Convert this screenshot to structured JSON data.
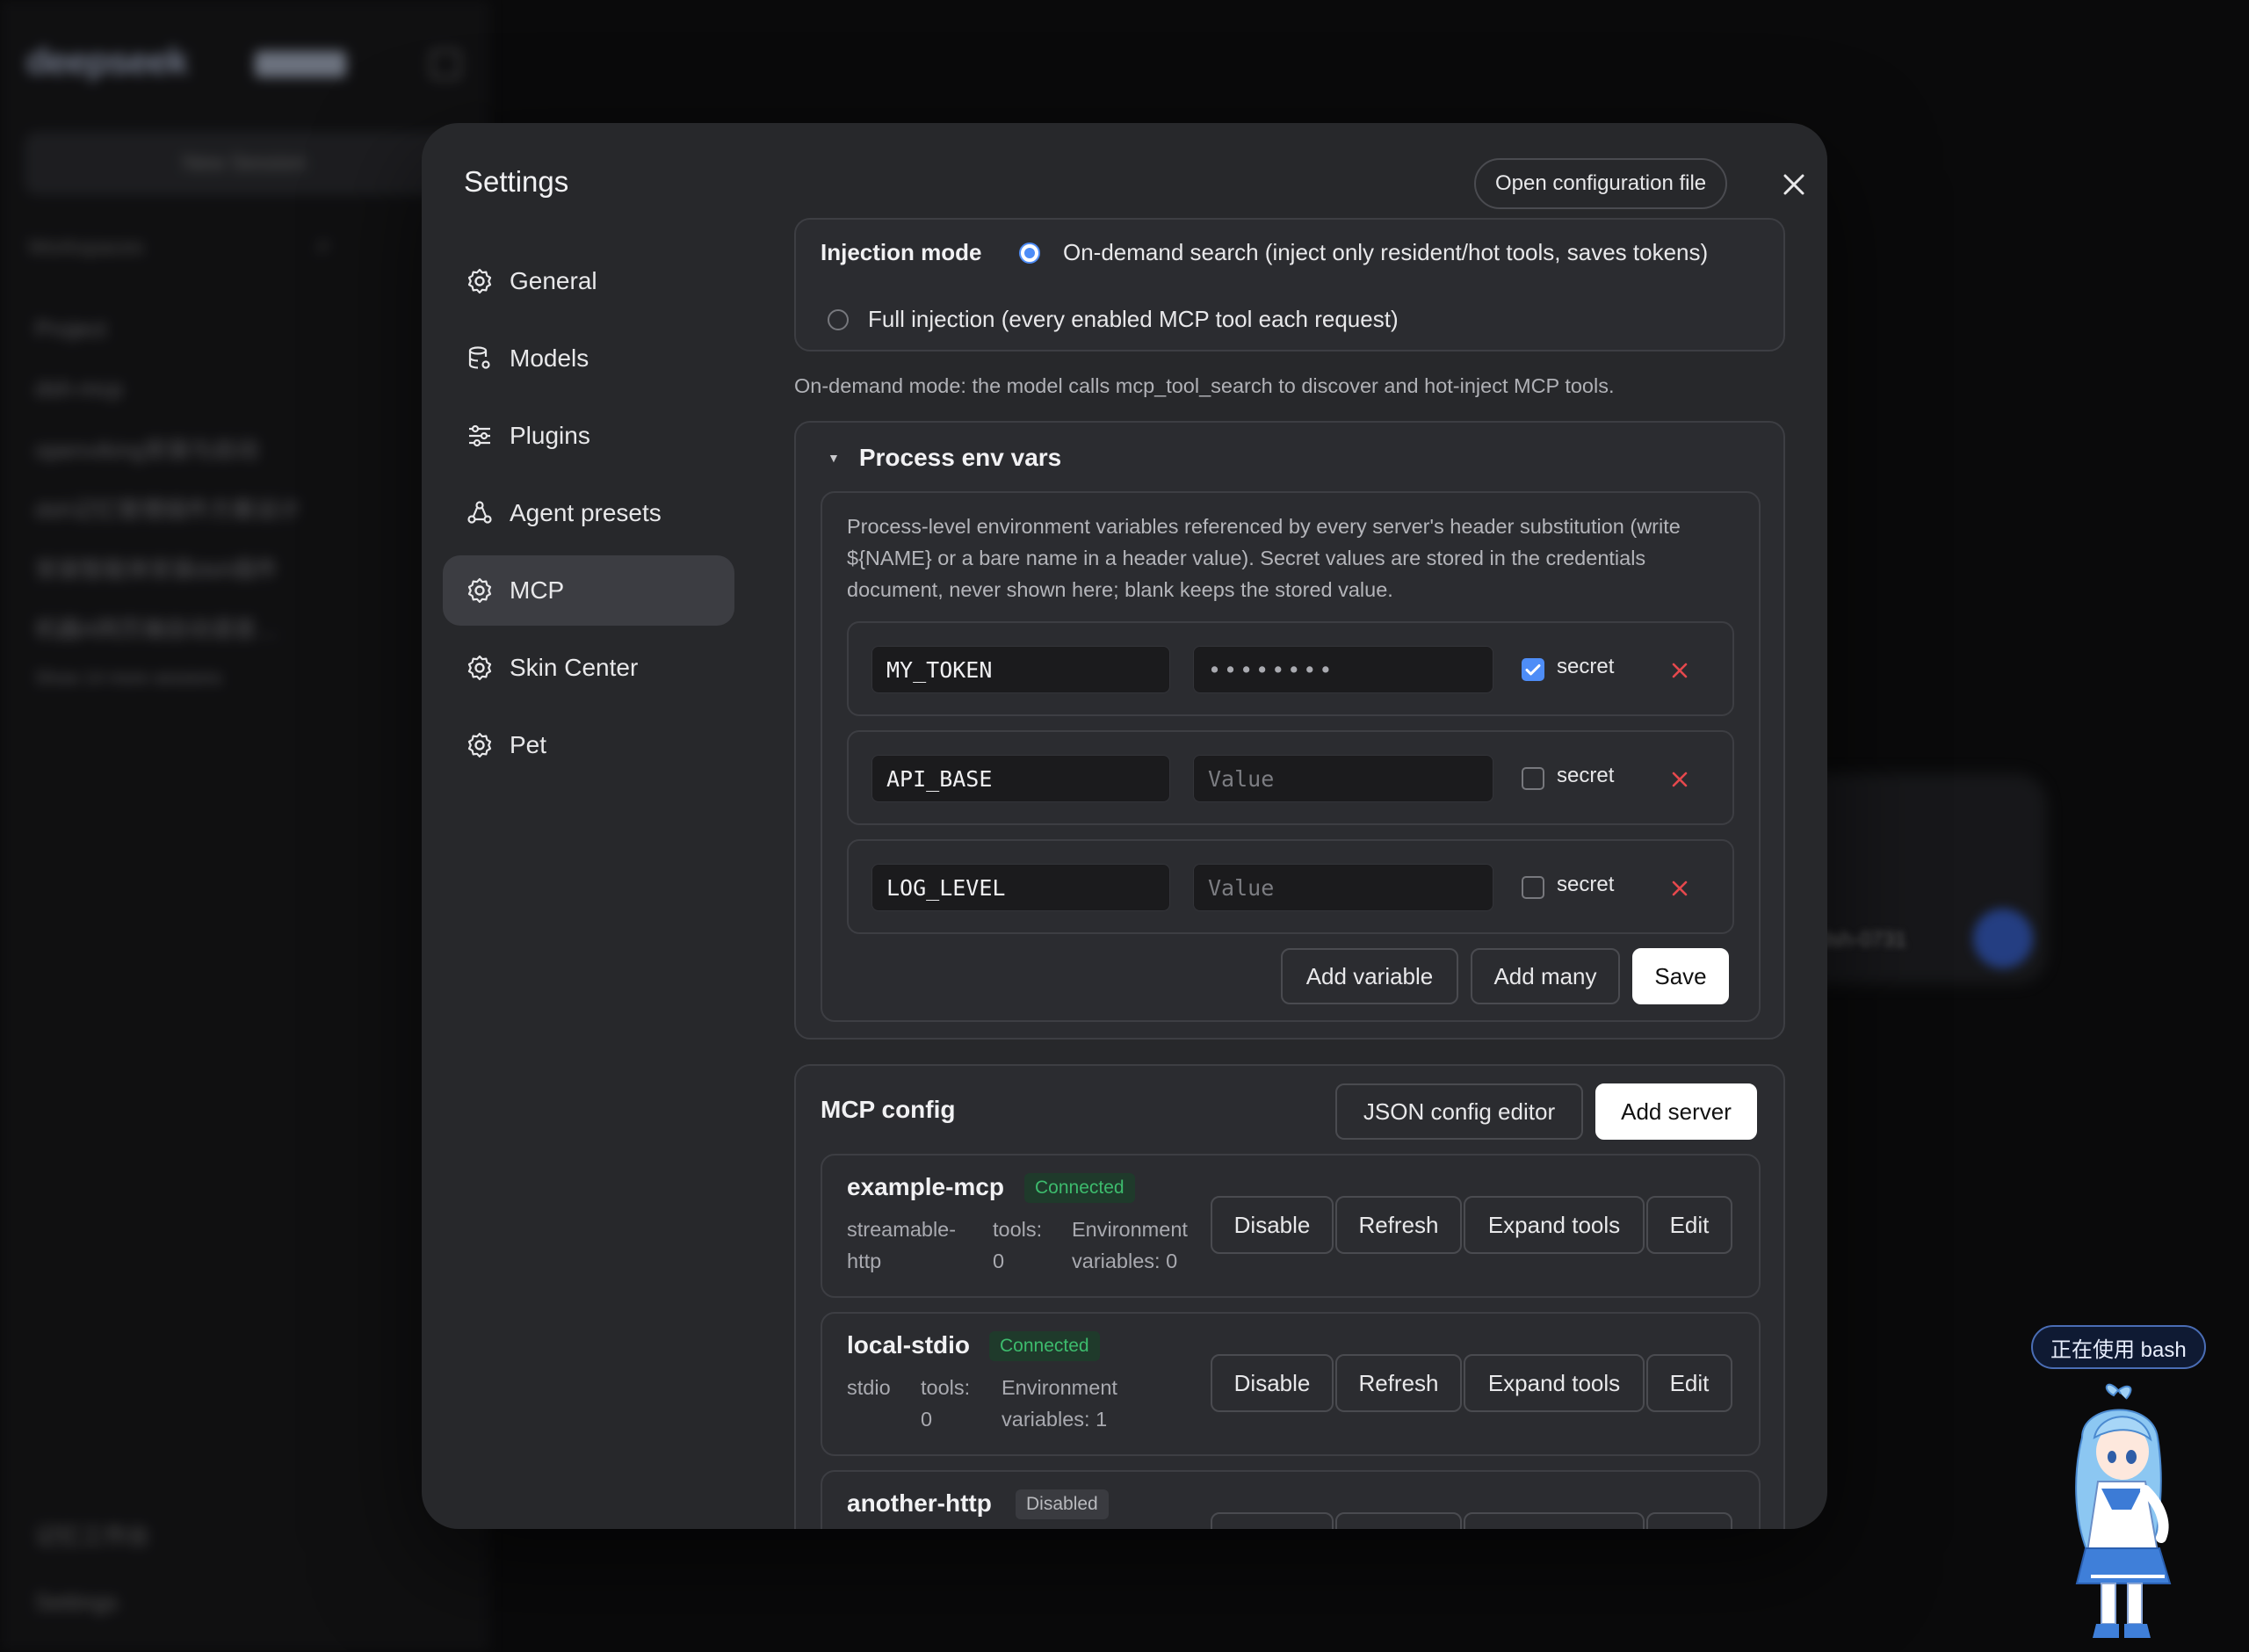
{
  "background": {
    "app_logo": "deepseek",
    "new_session": "New Session",
    "workspaces_label": "Workspaces",
    "sessions": [
      "Project",
      "dsh-mcp",
      "openviking安装与启动",
      "dsh记忆管理插件方案设计",
      "安装智能体安装dsh插件",
      "机器A网页端自动语音…"
    ],
    "show_more": "Show 14 more sessions",
    "footer_workspace": "记忆工作台",
    "footer_settings": "Settings",
    "card_text": "dsh-0731"
  },
  "dialog": {
    "title": "Settings",
    "open_config_label": "Open configuration file",
    "nav": [
      {
        "label": "General",
        "icon": "gear-icon"
      },
      {
        "label": "Models",
        "icon": "database-icon"
      },
      {
        "label": "Plugins",
        "icon": "sliders-icon"
      },
      {
        "label": "Agent presets",
        "icon": "agent-icon"
      },
      {
        "label": "MCP",
        "icon": "gear-icon",
        "active": true
      },
      {
        "label": "Skin Center",
        "icon": "gear-icon"
      },
      {
        "label": "Pet",
        "icon": "gear-icon"
      }
    ]
  },
  "injection": {
    "label": "Injection mode",
    "options": [
      {
        "label": "On-demand search (inject only resident/hot tools, saves tokens)",
        "selected": true
      },
      {
        "label": "Full injection (every enabled MCP tool each request)",
        "selected": false
      }
    ],
    "note": "On-demand mode: the model calls mcp_tool_search to discover and hot-inject MCP tools."
  },
  "env": {
    "title": "Process env vars",
    "description": "Process-level environment variables referenced by every server's header substitution (write ${NAME} or a bare name in a header value). Secret values are stored in the credentials document, never shown here; blank keeps the stored value.",
    "secret_label": "secret",
    "value_placeholder": "Value",
    "rows": [
      {
        "key": "MY_TOKEN",
        "value": "••••••••",
        "secret": true
      },
      {
        "key": "API_BASE",
        "value": "",
        "secret": false
      },
      {
        "key": "LOG_LEVEL",
        "value": "",
        "secret": false
      }
    ],
    "add_variable": "Add variable",
    "add_many": "Add many",
    "save": "Save"
  },
  "mcp": {
    "title": "MCP config",
    "json_editor": "JSON config editor",
    "add_server": "Add server",
    "buttons": {
      "disable": "Disable",
      "refresh": "Refresh",
      "expand": "Expand tools",
      "edit": "Edit"
    },
    "servers": [
      {
        "name": "example-mcp",
        "status": "Connected",
        "transport": "streamable-\nhttp",
        "tools": "tools:\n0",
        "env": "Environment\nvariables: 0"
      },
      {
        "name": "local-stdio",
        "status": "Connected",
        "transport": "stdio",
        "tools": "tools:\n0",
        "env": "Environment\nvariables: 1"
      },
      {
        "name": "another-http",
        "status": "Disabled"
      }
    ]
  },
  "pet": {
    "bubble": "正在使用 bash"
  },
  "colors": {
    "accent": "#4e8df7",
    "connected": "#3dbb6d",
    "danger": "#e5484d",
    "dialog_bg": "#27282b"
  }
}
